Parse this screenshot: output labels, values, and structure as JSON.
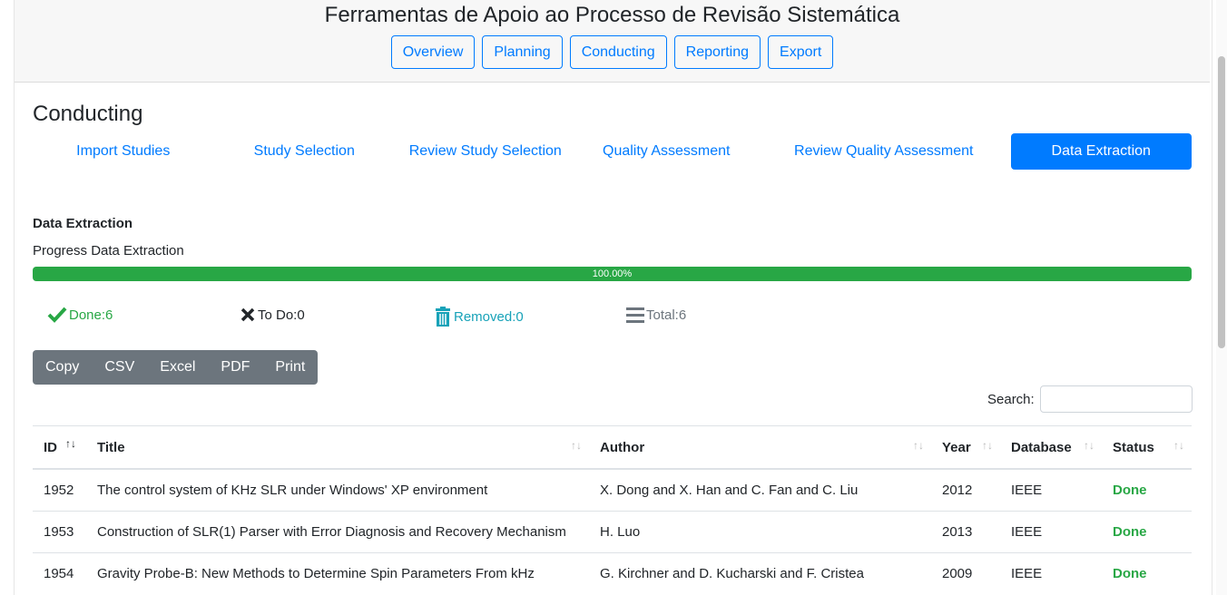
{
  "app": {
    "title": "Ferramentas de Apoio ao Processo de Revisão Sistemática"
  },
  "top_nav": [
    "Overview",
    "Planning",
    "Conducting",
    "Reporting",
    "Export"
  ],
  "section": {
    "title": "Conducting"
  },
  "sub_nav": [
    {
      "label": "Import Studies",
      "active": false
    },
    {
      "label": "Study Selection",
      "active": false
    },
    {
      "label": "Review Study Selection",
      "active": false
    },
    {
      "label": "Quality Assessment",
      "active": false
    },
    {
      "label": "Review Quality Assessment",
      "active": false
    },
    {
      "label": "Data Extraction",
      "active": true
    }
  ],
  "extraction": {
    "heading": "Data Extraction",
    "progress_label": "Progress Data Extraction",
    "progress_value": 100,
    "progress_text": "100.00%"
  },
  "stats": {
    "done": {
      "label": "Done:",
      "value": "6"
    },
    "todo": {
      "label": "To Do:",
      "value": "0"
    },
    "removed": {
      "label": "Removed:",
      "value": "0"
    },
    "total": {
      "label": "Total:",
      "value": "6"
    }
  },
  "export_buttons": [
    "Copy",
    "CSV",
    "Excel",
    "PDF",
    "Print"
  ],
  "search": {
    "label": "Search:",
    "value": ""
  },
  "table": {
    "columns": [
      "ID",
      "Title",
      "Author",
      "Year",
      "Database",
      "Status"
    ],
    "rows": [
      {
        "id": "1952",
        "title": "The control system of KHz SLR under Windows' XP environment",
        "author": "X. Dong and X. Han and C. Fan and C. Liu",
        "year": "2012",
        "database": "IEEE",
        "status": "Done"
      },
      {
        "id": "1953",
        "title": "Construction of SLR(1) Parser with Error Diagnosis and Recovery Mechanism",
        "author": "H. Luo",
        "year": "2013",
        "database": "IEEE",
        "status": "Done"
      },
      {
        "id": "1954",
        "title": "Gravity Probe-B: New Methods to Determine Spin Parameters From kHz",
        "author": "G. Kirchner and D. Kucharski and F. Cristea",
        "year": "2009",
        "database": "IEEE",
        "status": "Done"
      }
    ]
  },
  "colors": {
    "primary": "#007bff",
    "success": "#28a745",
    "info": "#17a2b8",
    "secondary": "#6c757d"
  }
}
